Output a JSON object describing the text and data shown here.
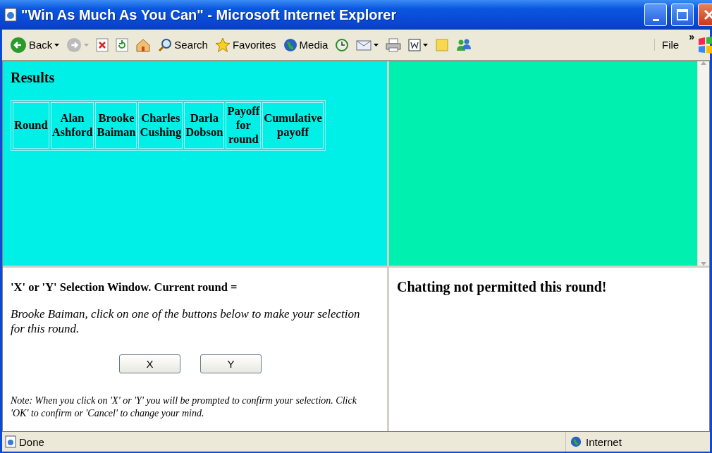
{
  "window": {
    "title": "\"Win As Much As You Can\" - Microsoft Internet Explorer"
  },
  "toolbar": {
    "items": [
      {
        "kind": "back",
        "label": "Back",
        "dropdown": true
      },
      {
        "kind": "forward",
        "dropdown": true,
        "disabled": true
      },
      {
        "kind": "stop"
      },
      {
        "kind": "refresh"
      },
      {
        "kind": "home"
      },
      {
        "kind": "search",
        "label": "Search"
      },
      {
        "kind": "favorites",
        "label": "Favorites"
      },
      {
        "kind": "media",
        "label": "Media"
      },
      {
        "kind": "history"
      },
      {
        "kind": "mail",
        "dropdown": true
      },
      {
        "kind": "print"
      },
      {
        "kind": "edit",
        "dropdown": true
      },
      {
        "kind": "note"
      },
      {
        "kind": "messenger"
      }
    ],
    "menu": "File",
    "more": "»"
  },
  "results": {
    "title": "Results",
    "columns": [
      "Round",
      "Alan Ashford",
      "Brooke Baiman",
      "Charles Cushing",
      "Darla Dobson",
      "Payoff for round",
      "Cumulative payoff"
    ]
  },
  "selection": {
    "title": "'X' or 'Y' Selection Window. Current round =",
    "instruction": "Brooke Baiman, click on one of the buttons below to make your selection for this round.",
    "buttons": [
      "X",
      "Y"
    ],
    "note": "Note: When you click on 'X' or 'Y' you will be prompted to confirm your selection. Click 'OK' to confirm or 'Cancel' to change your mind."
  },
  "chat": {
    "message": "Chatting not permitted this round!"
  },
  "status_bar": {
    "text": "Done",
    "zone": "Internet"
  }
}
